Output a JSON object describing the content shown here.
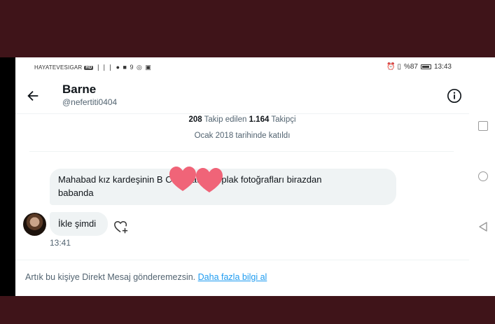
{
  "status_bar": {
    "carrier": "HAYATEVESIGAR",
    "hd": "HD",
    "icons": "❘❘❘ ● ■ 9 ◎ ▣",
    "right_icons": "⏰ ▯",
    "battery_percent": "%87",
    "time": "13:43"
  },
  "header": {
    "display_name": "Barne",
    "handle": "@nefertiti0404"
  },
  "profile": {
    "following_count": "208",
    "following_label": "Takip edilen",
    "followers_count": "1.164",
    "followers_label": "Takipçi",
    "joined": "Ocak 2018 tarihinde katıldı"
  },
  "messages": [
    {
      "text_line1": "Mahabad kız kardeşinin B     Ce     ye attığı çıplak fotoğrafları birazdan",
      "text_line2": "babanda"
    },
    {
      "text": "İkle şimdi",
      "time": "13:41"
    }
  ],
  "dm_notice": {
    "text": "Artık bu kişiye Direkt Mesaj gönderemezsin.",
    "link": "Daha fazla bilgi al"
  },
  "colors": {
    "accent": "#1d9bf0",
    "bubble": "#eff3f4",
    "hearts": "#f06478",
    "frame": "#3f1419"
  }
}
